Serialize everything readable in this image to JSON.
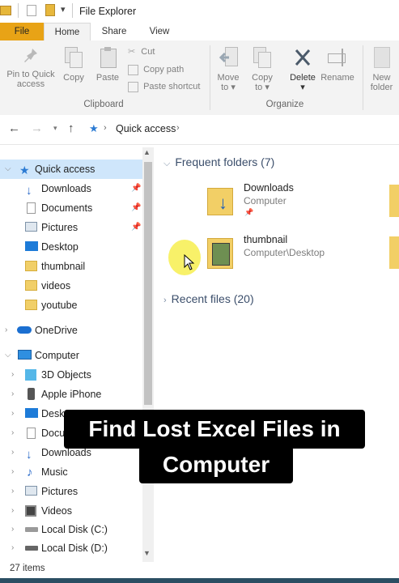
{
  "window": {
    "title": "File Explorer"
  },
  "tabs": {
    "file": "File",
    "home": "Home",
    "share": "Share",
    "view": "View"
  },
  "ribbon": {
    "clipboard": {
      "pin_to_quick_access": [
        "Pin to Quick",
        "access"
      ],
      "copy": "Copy",
      "paste": "Paste",
      "cut": "Cut",
      "copy_path": "Copy path",
      "paste_shortcut": "Paste shortcut",
      "group_label": "Clipboard"
    },
    "organize": {
      "move_to": [
        "Move",
        "to"
      ],
      "copy_to": [
        "Copy",
        "to"
      ],
      "delete": "Delete",
      "rename": "Rename",
      "group_label": "Organize"
    },
    "new": {
      "new_folder": [
        "New",
        "folder"
      ]
    }
  },
  "address": {
    "path": "Quick access"
  },
  "sidebar": {
    "quick_access": "Quick access",
    "quick_items": [
      "Downloads",
      "Documents",
      "Pictures",
      "Desktop",
      "thumbnail",
      "videos",
      "youtube"
    ],
    "onedrive": "OneDrive",
    "computer": "Computer",
    "computer_items": [
      "3D Objects",
      "Apple iPhone",
      "Desktop",
      "Documents",
      "Downloads",
      "Music",
      "Pictures",
      "Videos",
      "Local Disk (C:)",
      "Local Disk (D:)"
    ]
  },
  "main": {
    "frequent_header": "Frequent folders (7)",
    "recent_header": "Recent files (20)",
    "folders": [
      {
        "name": "Downloads",
        "location": "Computer"
      },
      {
        "name": "thumbnail",
        "location": "Computer\\Desktop"
      }
    ]
  },
  "status": {
    "items": "27 items"
  },
  "caption": {
    "line1": "Find Lost Excel Files in",
    "line2": "Computer"
  },
  "colors": {
    "accent_file_tab": "#e8a316",
    "selection": "#cfe6fb",
    "caption_bg": "#000000"
  }
}
